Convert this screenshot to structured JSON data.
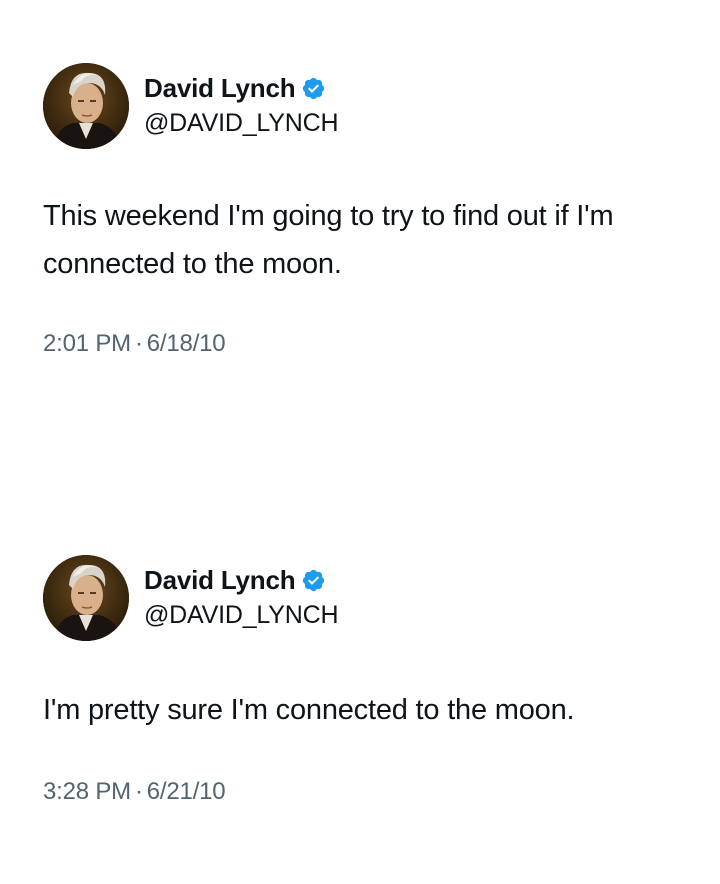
{
  "tweets": [
    {
      "author": {
        "name": "David Lynch",
        "handle": "@DAVID_LYNCH",
        "verified": true,
        "avatar_icon": "profile-photo"
      },
      "text": "This weekend I'm going to try to find out if I'm connected to the moon.",
      "time": "2:01 PM",
      "separator": "·",
      "date": "6/18/10"
    },
    {
      "author": {
        "name": "David Lynch",
        "handle": "@DAVID_LYNCH",
        "verified": true,
        "avatar_icon": "profile-photo"
      },
      "text": "I'm pretty sure I'm connected to the moon.",
      "time": "3:28 PM",
      "separator": "·",
      "date": "6/21/10"
    }
  ],
  "colors": {
    "text_primary": "#0f1419",
    "text_secondary": "#536471",
    "verified_badge": "#1d9bf0",
    "background": "#ffffff"
  }
}
